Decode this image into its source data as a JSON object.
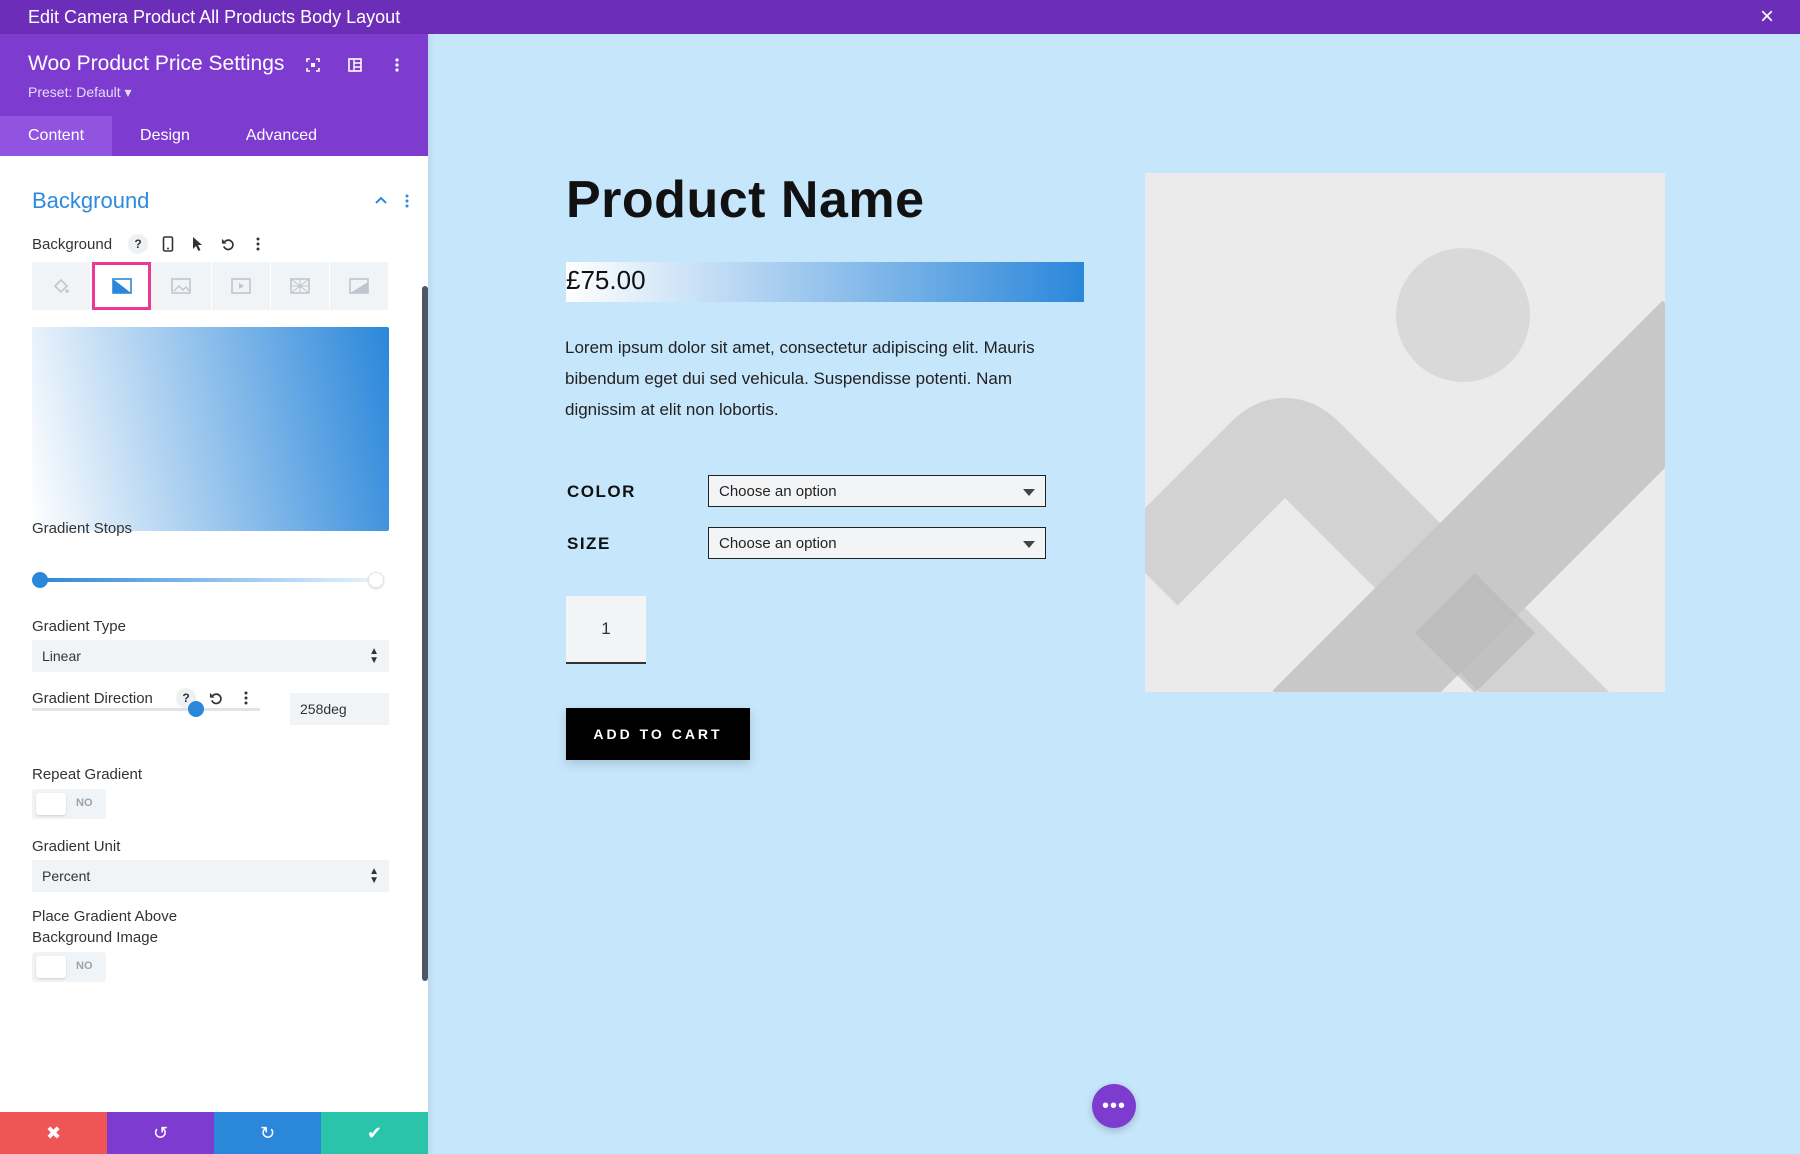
{
  "window": {
    "title": "Edit Camera Product All Products Body Layout",
    "close_icon": "×"
  },
  "panel": {
    "title": "Woo Product Price Settings",
    "preset": "Preset: Default ▾",
    "tabs": [
      {
        "label": "Content",
        "active": true
      },
      {
        "label": "Design",
        "active": false
      },
      {
        "label": "Advanced",
        "active": false
      }
    ],
    "section": {
      "title": "Background",
      "background_label": "Background",
      "bg_type_tabs": [
        "color",
        "gradient",
        "image",
        "video",
        "pattern",
        "mask"
      ],
      "selected_bg_tab": "gradient",
      "gradient_preview": {
        "direction": "258deg",
        "start_color": "#ffffff",
        "end_color": "#2b87da"
      },
      "gradient_stops_label": "Gradient Stops",
      "gradient_stops": [
        {
          "color": "#2b87da",
          "position": 0
        },
        {
          "color": "#ffffff",
          "position": 100
        }
      ],
      "gradient_type_label": "Gradient Type",
      "gradient_type_value": "Linear",
      "gradient_direction_label": "Gradient Direction",
      "gradient_direction_value": "258deg",
      "gradient_direction_slider_fraction": 0.72,
      "repeat_gradient_label": "Repeat Gradient",
      "repeat_gradient_value": "NO",
      "gradient_unit_label": "Gradient Unit",
      "gradient_unit_value": "Percent",
      "place_above_label_line1": "Place Gradient Above",
      "place_above_label_line2": "Background Image",
      "place_above_value": "NO"
    },
    "footer": {
      "cancel": "✖",
      "undo": "↺",
      "redo": "↻",
      "save": "✔"
    }
  },
  "preview": {
    "product_name": "Product Name",
    "price": "£75.00",
    "description": "Lorem ipsum dolor sit amet, consectetur adipiscing elit. Mauris bibendum eget dui sed vehicula. Suspendisse potenti. Nam dignissim at elit non lobortis.",
    "variations": [
      {
        "label": "COLOR",
        "value": "Choose an option"
      },
      {
        "label": "SIZE",
        "value": "Choose an option"
      }
    ],
    "quantity": "1",
    "add_to_cart": "ADD TO CART",
    "fab": "•••"
  },
  "colors": {
    "topbar": "#6c2eb9",
    "panel_header": "#7e3bd0",
    "accent_blue": "#2b87da",
    "selected_outline": "#ea3a93",
    "preview_bg": "#c6e6fb",
    "footer_cancel": "#ef5555",
    "footer_undo": "#7e3bd0",
    "footer_redo": "#2b87da",
    "footer_save": "#29c4a9"
  }
}
